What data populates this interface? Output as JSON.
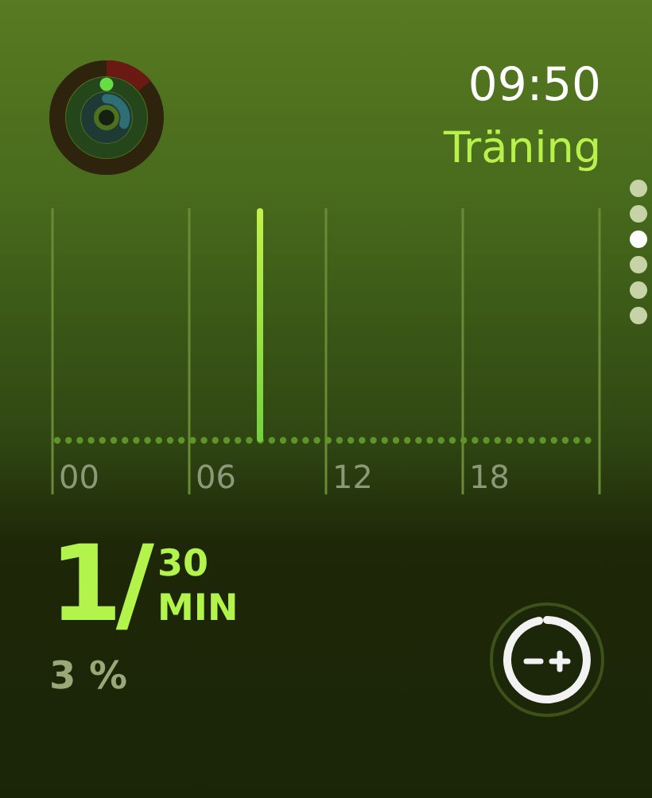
{
  "time": "09:50",
  "title": "Träning",
  "pages": [
    {
      "selected": false
    },
    {
      "selected": false
    },
    {
      "selected": true
    },
    {
      "selected": false
    },
    {
      "selected": false
    },
    {
      "selected": false
    }
  ],
  "chart": {
    "hour_labels": [
      "00",
      "06",
      "12",
      "18"
    ]
  },
  "progress": {
    "value": "1/",
    "goal": "30",
    "unit": "MIN",
    "percent": "3 %"
  }
}
